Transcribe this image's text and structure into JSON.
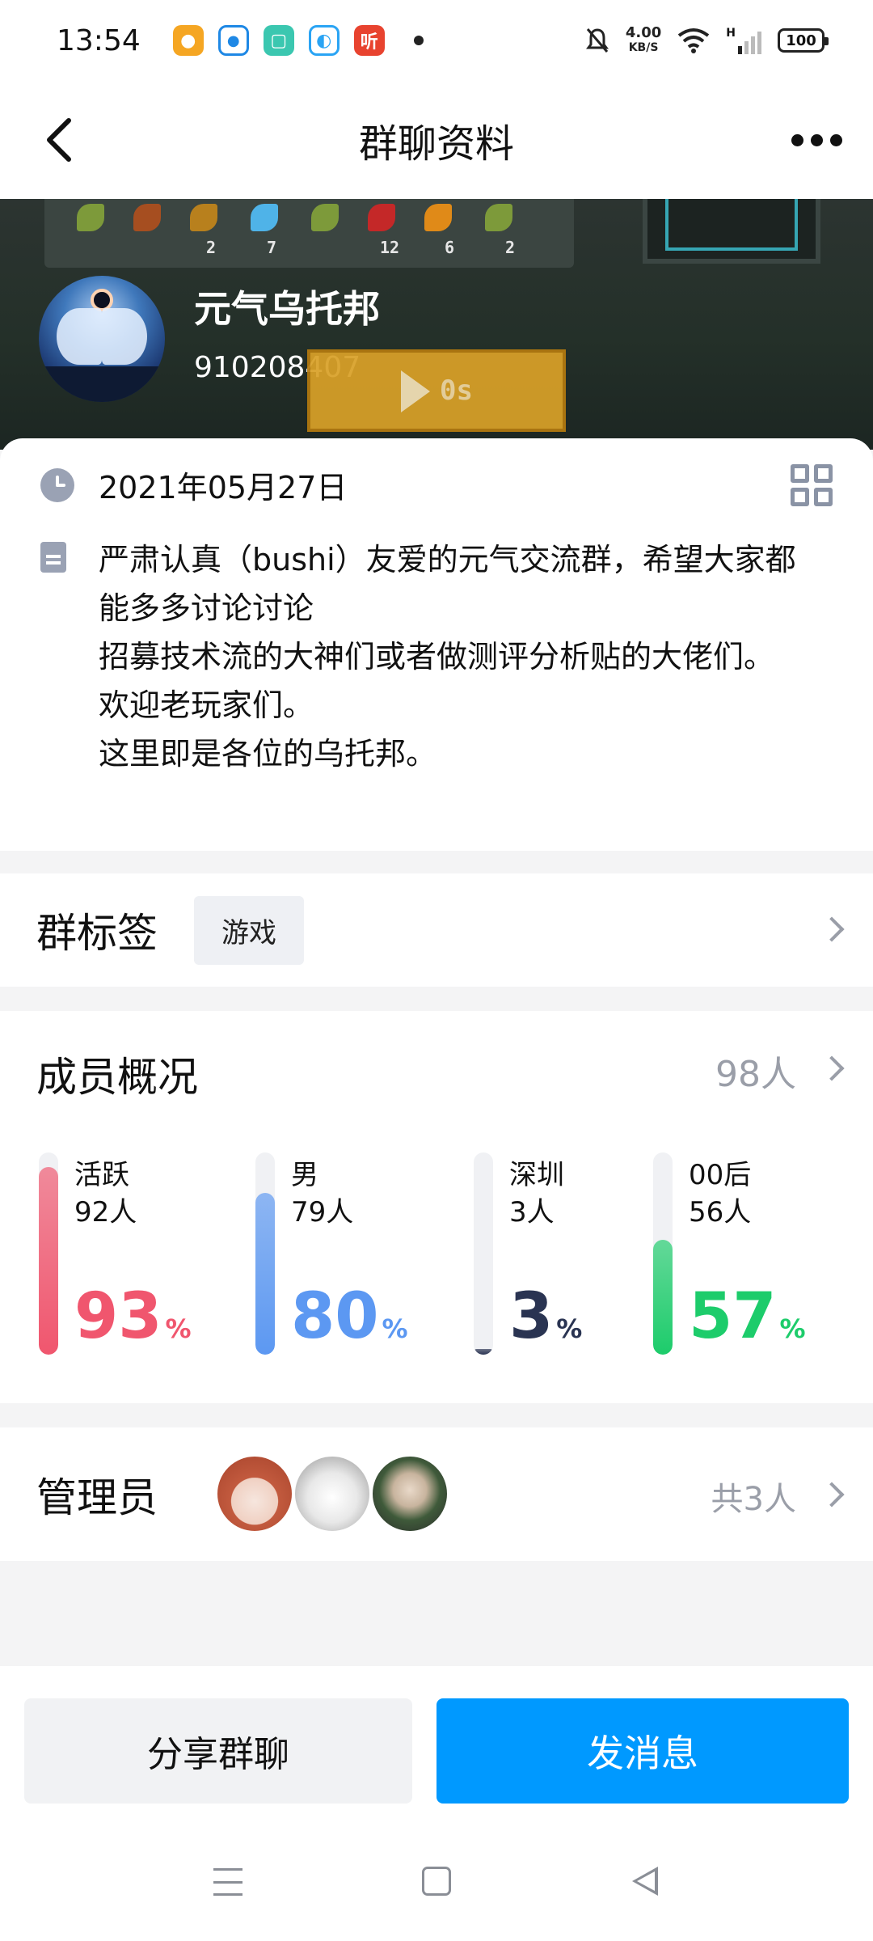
{
  "status_bar": {
    "time": "13:54",
    "net_speed_value": "4.00",
    "net_speed_unit": "KB/S",
    "signal_label": "H",
    "battery": "100",
    "notification_icons": [
      "weibo-icon",
      "app-icon",
      "app-icon",
      "app-icon",
      "listen-app-icon"
    ],
    "listen_app_label": "听"
  },
  "header": {
    "title": "群聊资料"
  },
  "group": {
    "name": "元气乌托邦",
    "id": "910208407",
    "voice_duration": "0s",
    "created_date": "2021年05月27日",
    "description": "严肃认真（bushi）友爱的元气交流群，希望大家都能多多讨论讨论\n招募技术流的大神们或者做测评分析贴的大佬们。\n欢迎老玩家们。\n这里即是各位的乌托邦。"
  },
  "banner_numbers": [
    "2",
    "7",
    "12",
    "6",
    "2"
  ],
  "tags": {
    "title": "群标签",
    "items": [
      "游戏"
    ]
  },
  "members": {
    "title": "成员概况",
    "total": "98人",
    "stats": [
      {
        "label": "活跃",
        "count": "92人",
        "value": "93",
        "unit": "%",
        "fraction": 0.93,
        "color": "#f0566e"
      },
      {
        "label": "男",
        "count": "79人",
        "value": "80",
        "unit": "%",
        "fraction": 0.8,
        "color": "#5c98f2"
      },
      {
        "label": "深圳",
        "count": "3人",
        "value": "3",
        "unit": "%",
        "fraction": 0.03,
        "color": "#2a3452"
      },
      {
        "label": "00后",
        "count": "56人",
        "value": "57",
        "unit": "%",
        "fraction": 0.57,
        "color": "#1dcc6b"
      }
    ]
  },
  "admins": {
    "title": "管理员",
    "total": "共3人"
  },
  "actions": {
    "share_label": "分享群聊",
    "send_label": "发消息"
  },
  "colors": {
    "accent_blue": "#0099ff",
    "muted_text": "#9a9ea8"
  }
}
